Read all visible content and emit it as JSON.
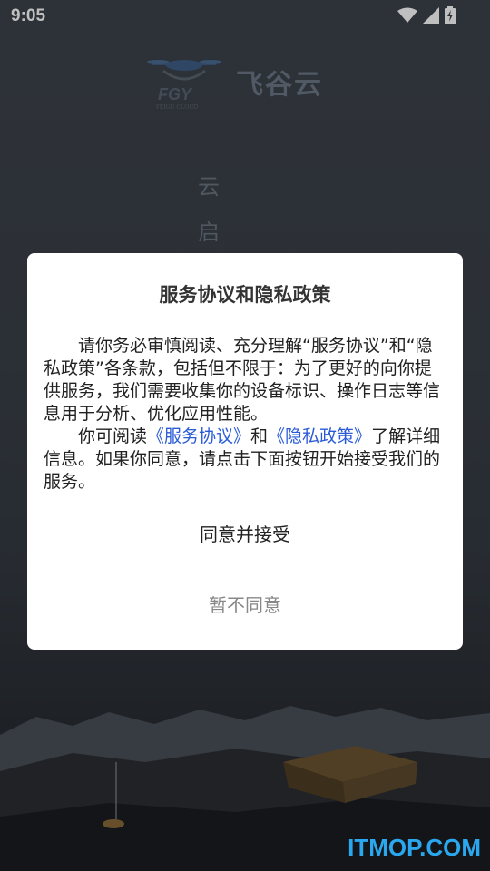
{
  "status_bar": {
    "time": "9:05"
  },
  "brand": {
    "logo_text": "飞谷云",
    "logo_mark": "FGY",
    "logo_sub": "FEIGU CLOUD"
  },
  "splash": {
    "line1": "云",
    "line2": "启"
  },
  "dialog": {
    "title": "服务协议和隐私政策",
    "para1": "请你务必审慎阅读、充分理解“服务协议”和“隐私政策”各条款，包括但不限于：为了更好的向你提供服务，我们需要收集你的设备标识、操作日志等信息用于分析、优化应用性能。",
    "para2_before": "你可阅读",
    "link_service": "《服务协议》",
    "para2_and": "和",
    "link_privacy": "《隐私政策》",
    "para2_after": "了解详细信息。如果你同意，请点击下面按钮开始接受我们的服务。",
    "agree_label": "同意并接受",
    "decline_label": "暂不同意"
  },
  "watermark": "ITMOP.COM"
}
